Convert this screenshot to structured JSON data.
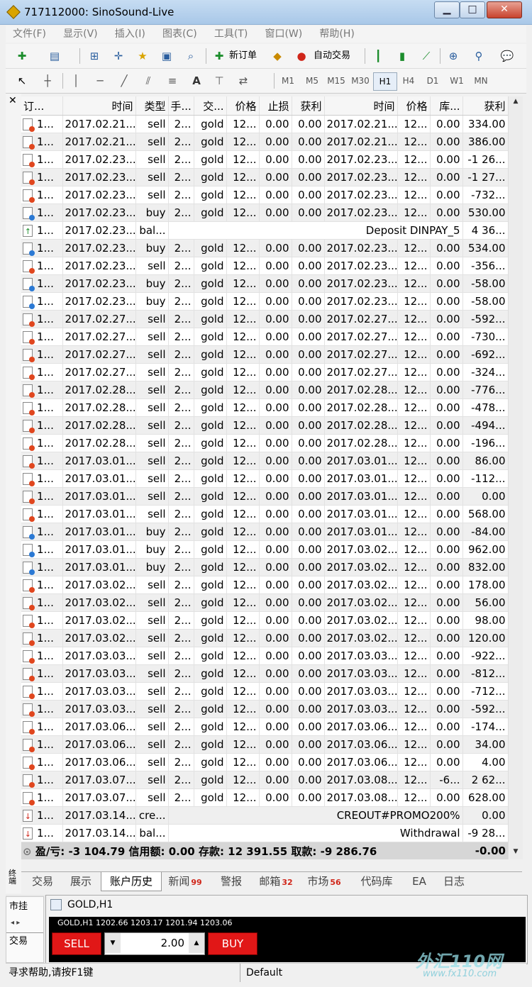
{
  "window": {
    "title": "717112000: SinoSound-Live",
    "minimize": "▁",
    "maximize": "□",
    "close": "✕"
  },
  "menu": [
    "文件(F)",
    "显示(V)",
    "插入(I)",
    "图表(C)",
    "工具(T)",
    "窗口(W)",
    "帮助(H)"
  ],
  "toolbar": {
    "new_order": "新订单",
    "auto_trade": "自动交易",
    "text_tool": "A"
  },
  "timeframes": [
    "M1",
    "M5",
    "M15",
    "M30",
    "H1",
    "H4",
    "D1",
    "W1",
    "MN"
  ],
  "active_timeframe": "H1",
  "grid": {
    "headers": [
      "订...",
      "时间",
      "类型",
      "手...",
      "交...",
      "价格",
      "止损",
      "获利",
      "时间",
      "价格",
      "库...",
      "获利"
    ],
    "rows": [
      {
        "icon": "sell",
        "c": [
          "1...",
          "2017.02.21...",
          "sell",
          "2...",
          "gold",
          "12...",
          "0.00",
          "0.00",
          "2017.02.21...",
          "12...",
          "0.00",
          "334.00"
        ]
      },
      {
        "icon": "sell",
        "c": [
          "1...",
          "2017.02.21...",
          "sell",
          "2...",
          "gold",
          "12...",
          "0.00",
          "0.00",
          "2017.02.21...",
          "12...",
          "0.00",
          "386.00"
        ]
      },
      {
        "icon": "sell",
        "c": [
          "1...",
          "2017.02.23...",
          "sell",
          "2...",
          "gold",
          "12...",
          "0.00",
          "0.00",
          "2017.02.23...",
          "12...",
          "0.00",
          "-1 26..."
        ]
      },
      {
        "icon": "sell",
        "c": [
          "1...",
          "2017.02.23...",
          "sell",
          "2...",
          "gold",
          "12...",
          "0.00",
          "0.00",
          "2017.02.23...",
          "12...",
          "0.00",
          "-1 27..."
        ]
      },
      {
        "icon": "sell",
        "c": [
          "1...",
          "2017.02.23...",
          "sell",
          "2...",
          "gold",
          "12...",
          "0.00",
          "0.00",
          "2017.02.23...",
          "12...",
          "0.00",
          "-732..."
        ]
      },
      {
        "icon": "buy",
        "c": [
          "1...",
          "2017.02.23...",
          "buy",
          "2...",
          "gold",
          "12...",
          "0.00",
          "0.00",
          "2017.02.23...",
          "12...",
          "0.00",
          "530.00"
        ]
      },
      {
        "icon": "dep",
        "span": true,
        "c": [
          "1...",
          "2017.02.23...",
          "bal...",
          "Deposit DINPAY_5",
          "4 36..."
        ]
      },
      {
        "icon": "buy",
        "c": [
          "1...",
          "2017.02.23...",
          "buy",
          "2...",
          "gold",
          "12...",
          "0.00",
          "0.00",
          "2017.02.23...",
          "12...",
          "0.00",
          "534.00"
        ]
      },
      {
        "icon": "sell",
        "c": [
          "1...",
          "2017.02.23...",
          "sell",
          "2...",
          "gold",
          "12...",
          "0.00",
          "0.00",
          "2017.02.23...",
          "12...",
          "0.00",
          "-356..."
        ]
      },
      {
        "icon": "buy",
        "c": [
          "1...",
          "2017.02.23...",
          "buy",
          "2...",
          "gold",
          "12...",
          "0.00",
          "0.00",
          "2017.02.23...",
          "12...",
          "0.00",
          "-58.00"
        ]
      },
      {
        "icon": "buy",
        "c": [
          "1...",
          "2017.02.23...",
          "buy",
          "2...",
          "gold",
          "12...",
          "0.00",
          "0.00",
          "2017.02.23...",
          "12...",
          "0.00",
          "-58.00"
        ]
      },
      {
        "icon": "sell",
        "c": [
          "1...",
          "2017.02.27...",
          "sell",
          "2...",
          "gold",
          "12...",
          "0.00",
          "0.00",
          "2017.02.27...",
          "12...",
          "0.00",
          "-592..."
        ]
      },
      {
        "icon": "sell",
        "c": [
          "1...",
          "2017.02.27...",
          "sell",
          "2...",
          "gold",
          "12...",
          "0.00",
          "0.00",
          "2017.02.27...",
          "12...",
          "0.00",
          "-730..."
        ]
      },
      {
        "icon": "sell",
        "c": [
          "1...",
          "2017.02.27...",
          "sell",
          "2...",
          "gold",
          "12...",
          "0.00",
          "0.00",
          "2017.02.27...",
          "12...",
          "0.00",
          "-692..."
        ]
      },
      {
        "icon": "sell",
        "c": [
          "1...",
          "2017.02.27...",
          "sell",
          "2...",
          "gold",
          "12...",
          "0.00",
          "0.00",
          "2017.02.27...",
          "12...",
          "0.00",
          "-324..."
        ]
      },
      {
        "icon": "sell",
        "c": [
          "1...",
          "2017.02.28...",
          "sell",
          "2...",
          "gold",
          "12...",
          "0.00",
          "0.00",
          "2017.02.28...",
          "12...",
          "0.00",
          "-776..."
        ]
      },
      {
        "icon": "sell",
        "c": [
          "1...",
          "2017.02.28...",
          "sell",
          "2...",
          "gold",
          "12...",
          "0.00",
          "0.00",
          "2017.02.28...",
          "12...",
          "0.00",
          "-478..."
        ]
      },
      {
        "icon": "sell",
        "c": [
          "1...",
          "2017.02.28...",
          "sell",
          "2...",
          "gold",
          "12...",
          "0.00",
          "0.00",
          "2017.02.28...",
          "12...",
          "0.00",
          "-494..."
        ]
      },
      {
        "icon": "sell",
        "c": [
          "1...",
          "2017.02.28...",
          "sell",
          "2...",
          "gold",
          "12...",
          "0.00",
          "0.00",
          "2017.02.28...",
          "12...",
          "0.00",
          "-196..."
        ]
      },
      {
        "icon": "sell",
        "c": [
          "1...",
          "2017.03.01...",
          "sell",
          "2...",
          "gold",
          "12...",
          "0.00",
          "0.00",
          "2017.03.01...",
          "12...",
          "0.00",
          "86.00"
        ]
      },
      {
        "icon": "sell",
        "c": [
          "1...",
          "2017.03.01...",
          "sell",
          "2...",
          "gold",
          "12...",
          "0.00",
          "0.00",
          "2017.03.01...",
          "12...",
          "0.00",
          "-112..."
        ]
      },
      {
        "icon": "sell",
        "c": [
          "1...",
          "2017.03.01...",
          "sell",
          "2...",
          "gold",
          "12...",
          "0.00",
          "0.00",
          "2017.03.01...",
          "12...",
          "0.00",
          "0.00"
        ]
      },
      {
        "icon": "sell",
        "c": [
          "1...",
          "2017.03.01...",
          "sell",
          "2...",
          "gold",
          "12...",
          "0.00",
          "0.00",
          "2017.03.01...",
          "12...",
          "0.00",
          "568.00"
        ]
      },
      {
        "icon": "buy",
        "c": [
          "1...",
          "2017.03.01...",
          "buy",
          "2...",
          "gold",
          "12...",
          "0.00",
          "0.00",
          "2017.03.01...",
          "12...",
          "0.00",
          "-84.00"
        ]
      },
      {
        "icon": "buy",
        "c": [
          "1...",
          "2017.03.01...",
          "buy",
          "2...",
          "gold",
          "12...",
          "0.00",
          "0.00",
          "2017.03.02...",
          "12...",
          "0.00",
          "962.00"
        ]
      },
      {
        "icon": "buy",
        "c": [
          "1...",
          "2017.03.01...",
          "buy",
          "2...",
          "gold",
          "12...",
          "0.00",
          "0.00",
          "2017.03.02...",
          "12...",
          "0.00",
          "832.00"
        ]
      },
      {
        "icon": "sell",
        "c": [
          "1...",
          "2017.03.02...",
          "sell",
          "2...",
          "gold",
          "12...",
          "0.00",
          "0.00",
          "2017.03.02...",
          "12...",
          "0.00",
          "178.00"
        ]
      },
      {
        "icon": "sell",
        "c": [
          "1...",
          "2017.03.02...",
          "sell",
          "2...",
          "gold",
          "12...",
          "0.00",
          "0.00",
          "2017.03.02...",
          "12...",
          "0.00",
          "56.00"
        ]
      },
      {
        "icon": "sell",
        "c": [
          "1...",
          "2017.03.02...",
          "sell",
          "2...",
          "gold",
          "12...",
          "0.00",
          "0.00",
          "2017.03.02...",
          "12...",
          "0.00",
          "98.00"
        ]
      },
      {
        "icon": "sell",
        "c": [
          "1...",
          "2017.03.02...",
          "sell",
          "2...",
          "gold",
          "12...",
          "0.00",
          "0.00",
          "2017.03.02...",
          "12...",
          "0.00",
          "120.00"
        ]
      },
      {
        "icon": "sell",
        "c": [
          "1...",
          "2017.03.03...",
          "sell",
          "2...",
          "gold",
          "12...",
          "0.00",
          "0.00",
          "2017.03.03...",
          "12...",
          "0.00",
          "-922..."
        ]
      },
      {
        "icon": "sell",
        "c": [
          "1...",
          "2017.03.03...",
          "sell",
          "2...",
          "gold",
          "12...",
          "0.00",
          "0.00",
          "2017.03.03...",
          "12...",
          "0.00",
          "-812..."
        ]
      },
      {
        "icon": "sell",
        "c": [
          "1...",
          "2017.03.03...",
          "sell",
          "2...",
          "gold",
          "12...",
          "0.00",
          "0.00",
          "2017.03.03...",
          "12...",
          "0.00",
          "-712..."
        ]
      },
      {
        "icon": "sell",
        "c": [
          "1...",
          "2017.03.03...",
          "sell",
          "2...",
          "gold",
          "12...",
          "0.00",
          "0.00",
          "2017.03.03...",
          "12...",
          "0.00",
          "-592..."
        ]
      },
      {
        "icon": "sell",
        "c": [
          "1...",
          "2017.03.06...",
          "sell",
          "2...",
          "gold",
          "12...",
          "0.00",
          "0.00",
          "2017.03.06...",
          "12...",
          "0.00",
          "-174..."
        ]
      },
      {
        "icon": "sell",
        "c": [
          "1...",
          "2017.03.06...",
          "sell",
          "2...",
          "gold",
          "12...",
          "0.00",
          "0.00",
          "2017.03.06...",
          "12...",
          "0.00",
          "34.00"
        ]
      },
      {
        "icon": "sell",
        "c": [
          "1...",
          "2017.03.06...",
          "sell",
          "2...",
          "gold",
          "12...",
          "0.00",
          "0.00",
          "2017.03.06...",
          "12...",
          "0.00",
          "4.00"
        ]
      },
      {
        "icon": "sell",
        "c": [
          "1...",
          "2017.03.07...",
          "sell",
          "2...",
          "gold",
          "12...",
          "0.00",
          "0.00",
          "2017.03.08...",
          "12...",
          "-6...",
          "2 62..."
        ]
      },
      {
        "icon": "sell",
        "c": [
          "1...",
          "2017.03.07...",
          "sell",
          "2...",
          "gold",
          "12...",
          "0.00",
          "0.00",
          "2017.03.08...",
          "12...",
          "0.00",
          "628.00"
        ]
      },
      {
        "icon": "wd",
        "span": true,
        "c": [
          "1...",
          "2017.03.14...",
          "cre...",
          "CREOUT#PROMO200%",
          "0.00"
        ]
      },
      {
        "icon": "wd",
        "span": true,
        "c": [
          "1...",
          "2017.03.14...",
          "bal...",
          "Withdrawal",
          "-9 28..."
        ]
      }
    ],
    "summary": {
      "text": "盈/亏: -3 104.79  信用额: 0.00  存款: 12 391.55  取款: -9 286.76",
      "total": "-0.00"
    }
  },
  "tabs": [
    {
      "label": "交易",
      "badge": ""
    },
    {
      "label": "展示",
      "badge": ""
    },
    {
      "label": "账户历史",
      "badge": "",
      "active": true
    },
    {
      "label": "新闻",
      "badge": "99"
    },
    {
      "label": "警报",
      "badge": ""
    },
    {
      "label": "邮箱",
      "badge": "32"
    },
    {
      "label": "市场",
      "badge": "56"
    },
    {
      "label": "代码库",
      "badge": ""
    },
    {
      "label": "EA",
      "badge": ""
    },
    {
      "label": "日志",
      "badge": ""
    }
  ],
  "side_label": "终端",
  "market_panel": {
    "title": "市挂",
    "tab": "交易"
  },
  "chart": {
    "title": "GOLD,H1",
    "ohlc": "GOLD,H1  1202.66 1203.17 1201.94 1203.06",
    "sell": "SELL",
    "buy": "BUY",
    "lot": "2.00"
  },
  "status": {
    "help": "寻求帮助,请按F1键",
    "profile": "Default"
  },
  "watermark": {
    "main": "外汇110网",
    "sub": "www.fx110.com"
  }
}
